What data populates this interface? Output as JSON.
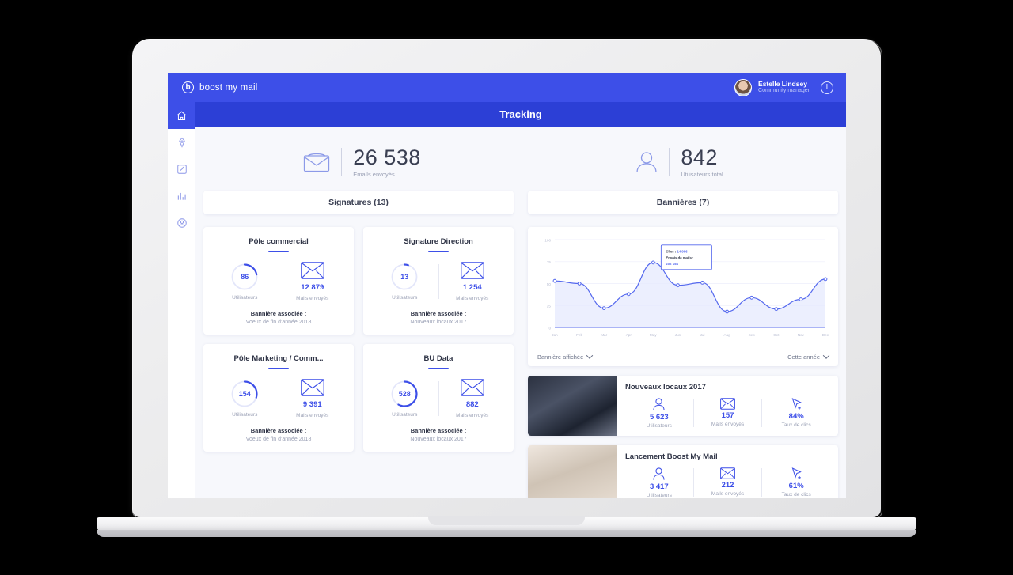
{
  "brand": {
    "name": "boost my mail",
    "logo_icon": "boost-logo-icon",
    "accent": "#3d4fe8",
    "title_bar_color": "#2c3fd6"
  },
  "header": {
    "user_name": "Estelle Lindsey",
    "user_role": "Community manager",
    "avatar_icon": "avatar",
    "power_icon": "power-icon"
  },
  "page": {
    "title": "Tracking"
  },
  "sidebar": {
    "items": [
      {
        "name": "sidebar-item-home",
        "icon": "home-icon",
        "active": true
      },
      {
        "name": "sidebar-item-signature",
        "icon": "pen-nib-icon",
        "active": false
      },
      {
        "name": "sidebar-item-campaigns",
        "icon": "edit-box-icon",
        "active": false
      },
      {
        "name": "sidebar-item-stats",
        "icon": "bar-chart-icon",
        "active": false
      },
      {
        "name": "sidebar-item-account",
        "icon": "user-circle-icon",
        "active": false
      }
    ]
  },
  "kpis": [
    {
      "icon": "envelope-icon",
      "value": "26 538",
      "label": "Emails envoyés"
    },
    {
      "icon": "user-icon",
      "value": "842",
      "label": "Utilisateurs total"
    }
  ],
  "signatures_section": {
    "heading": "Signatures (13)",
    "labels": {
      "users": "Utilisateurs",
      "mails": "Mails envoyés",
      "associated": "Bannière associée :"
    },
    "cards": [
      {
        "title": "Pôle commercial",
        "users": "86",
        "users_pct": 22,
        "mails": "12 879",
        "banner": "Voeux de fin d'année 2018"
      },
      {
        "title": "Signature Direction",
        "users": "13",
        "users_pct": 5,
        "mails": "1 254",
        "banner": "Nouveaux locaux 2017"
      },
      {
        "title": "Pôle Marketing / Comm...",
        "users": "154",
        "users_pct": 30,
        "mails": "9 391",
        "banner": "Voeux de fin d'année 2018"
      },
      {
        "title": "BU Data",
        "users": "528",
        "users_pct": 58,
        "mails": "882",
        "banner": "Nouveaux locaux 2017"
      }
    ]
  },
  "banners_section": {
    "heading": "Bannières (7)",
    "chart_filter_left": "Bannière affichée",
    "chart_filter_right": "Cette année",
    "labels": {
      "users": "Utilisateurs",
      "mails": "Mails envoyés",
      "ctr": "Taux de clics"
    },
    "items": [
      {
        "title": "Nouveaux locaux 2017",
        "thumb": "office-building-photo",
        "users": "5 623",
        "mails": "157",
        "ctr": "84%",
        "user_icon": "user-icon",
        "mail_icon": "envelope-icon",
        "ctr_icon": "cursor-click-icon"
      },
      {
        "title": "Lancement Boost My Mail",
        "thumb": "astronaut-photo",
        "users": "3 417",
        "mails": "212",
        "ctr": "61%",
        "user_icon": "user-icon",
        "mail_icon": "envelope-icon",
        "ctr_icon": "cursor-click-icon"
      }
    ]
  },
  "chart_data": {
    "type": "area",
    "title": "",
    "xlabel": "",
    "ylabel": "",
    "categories": [
      "Jan",
      "Feb",
      "Mar",
      "Apr",
      "May",
      "Jun",
      "Jul",
      "Aug",
      "Sep",
      "Oct",
      "Nov",
      "Dec"
    ],
    "values": [
      53,
      50,
      22,
      38,
      74,
      48,
      51,
      18,
      34,
      21,
      32,
      55
    ],
    "ylim": [
      0,
      100
    ],
    "yticks": [
      0,
      25,
      50,
      75,
      100
    ],
    "grid": true,
    "legend": "none",
    "line_color": "#5468ee",
    "fill_color": "#e5e9fd",
    "tooltip": {
      "anchor_category": "May",
      "line1_label": "Clics :",
      "line1_value": "14 986",
      "line2_label": "Envois de mails :",
      "line2_value": "202 154"
    }
  }
}
